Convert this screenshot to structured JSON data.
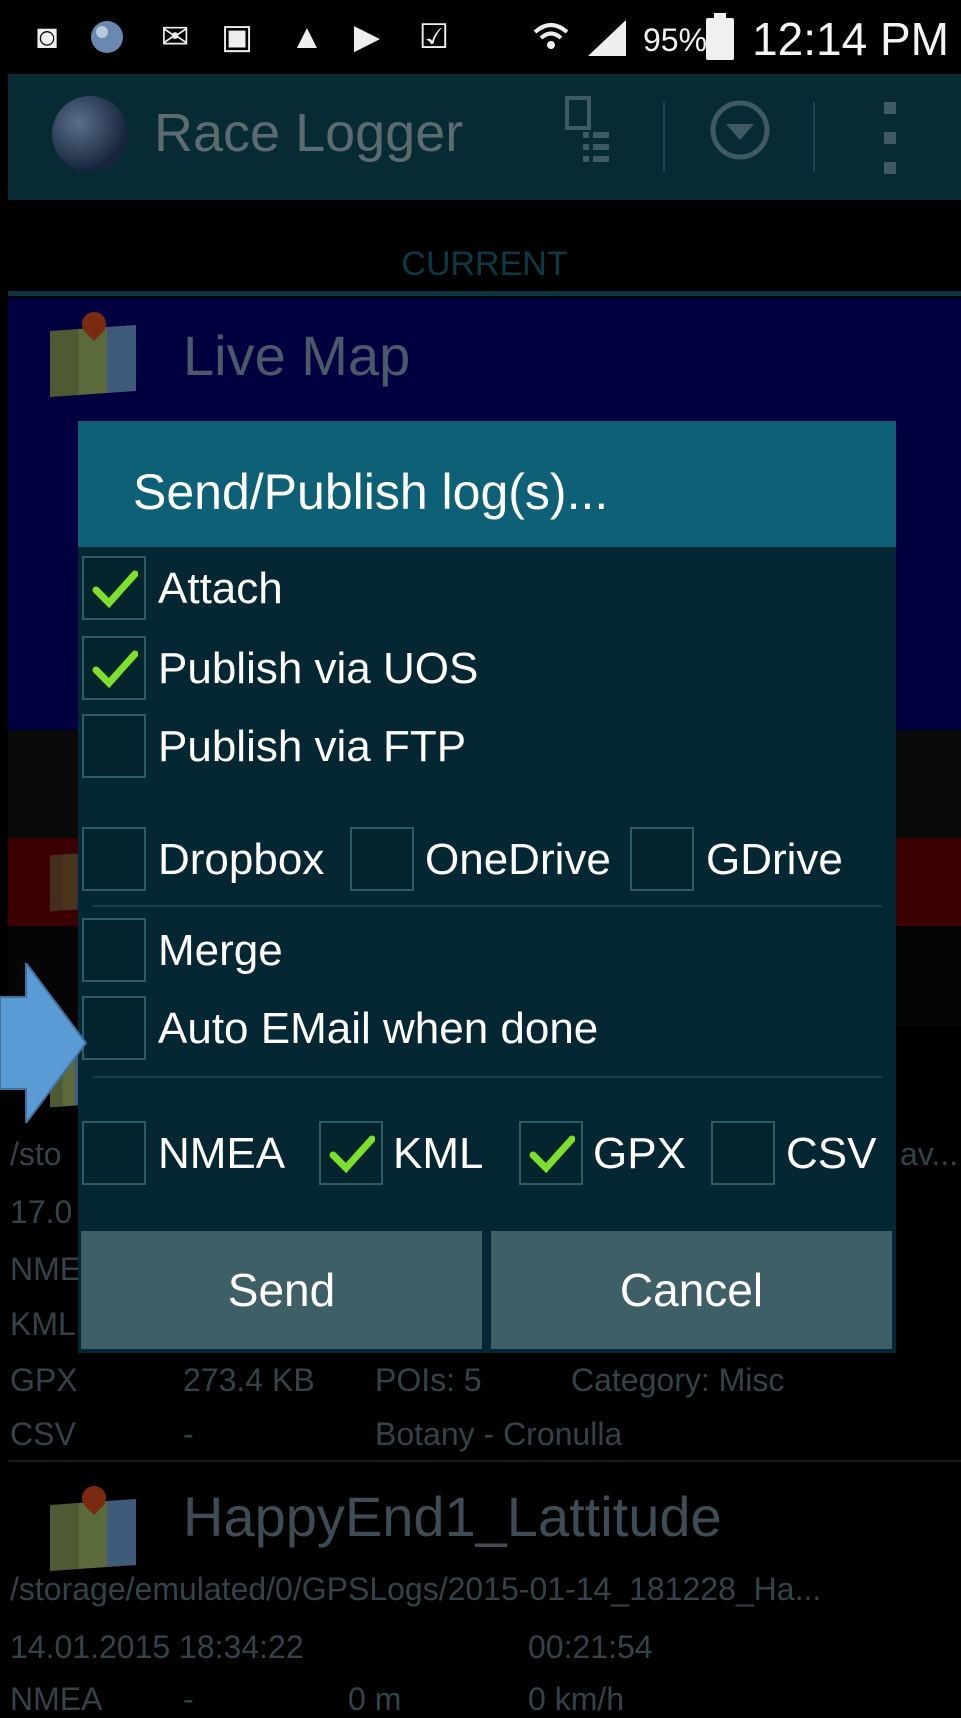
{
  "status_bar": {
    "time": "12:14 PM",
    "battery_percent": "95%",
    "icons": [
      "voicemail-icon",
      "globe-notification-icon",
      "email-notification-icon",
      "image-icon",
      "navigation-icon",
      "briefcase-icon",
      "clipboard-check-icon",
      "wifi-icon",
      "signal-icon",
      "battery-icon"
    ]
  },
  "app_bar": {
    "title": "Race Logger",
    "actions": [
      "log-list-icon",
      "dropdown-circle-icon",
      "overflow-menu-icon"
    ]
  },
  "tabs": {
    "current": "CURRENT"
  },
  "live_map": {
    "title": "Live Map"
  },
  "background_log": {
    "path_fragment_left": "/sto",
    "path_fragment_right": "av...",
    "date_fragment": "17.0",
    "nmea_fragment": "NME",
    "kml_fragment": "KML",
    "gpx_label": "GPX",
    "gpx_size": "273.4 KB",
    "pois": "POIs: 5",
    "category": "Category: Misc",
    "csv_label": "CSV",
    "csv_size": "-",
    "route": "Botany - Cronulla"
  },
  "happyend_log": {
    "title": "HappyEnd1_Lattitude",
    "path": "/storage/emulated/0/GPSLogs/2015-01-14_181228_Ha...",
    "datetime": "14.01.2015 18:34:22",
    "duration": "00:21:54",
    "nmea_label": "NMEA",
    "nmea_size": "-",
    "distance": "0 m",
    "speed": "0 km/h"
  },
  "dialog": {
    "title": "Send/Publish log(s)...",
    "attach": {
      "label": "Attach",
      "checked": true
    },
    "publish_uos": {
      "label": "Publish via UOS",
      "checked": true
    },
    "publish_ftp": {
      "label": "Publish via FTP",
      "checked": false
    },
    "dropbox": {
      "label": "Dropbox",
      "checked": false
    },
    "onedrive": {
      "label": "OneDrive",
      "checked": false
    },
    "gdrive": {
      "label": "GDrive",
      "checked": false
    },
    "merge": {
      "label": "Merge",
      "checked": false
    },
    "auto_email": {
      "label": "Auto EMail when done",
      "checked": false
    },
    "nmea": {
      "label": "NMEA",
      "checked": false
    },
    "kml": {
      "label": "KML",
      "checked": true
    },
    "gpx": {
      "label": "GPX",
      "checked": true
    },
    "csv": {
      "label": "CSV",
      "checked": false
    },
    "send_label": "Send",
    "cancel_label": "Cancel"
  },
  "colors": {
    "check_green": "#7ee02c",
    "dialog_bg": "#042733",
    "dialog_title_bg": "#0d6075",
    "button_bg": "#3f5f66",
    "arrow_blue": "#5b9bd5"
  }
}
